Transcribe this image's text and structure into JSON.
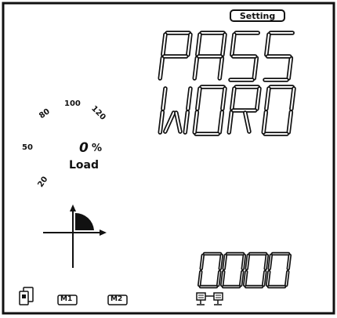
{
  "header": {
    "setting_label": "Setting"
  },
  "display": {
    "line1": "PASS",
    "line2": "WORD",
    "value": "0000"
  },
  "load_gauge": {
    "ticks": [
      "20",
      "50",
      "80",
      "100",
      "120"
    ],
    "percent_value": "0",
    "percent_symbol": "%",
    "label": "Load"
  },
  "footer": {
    "m1_label": "M1",
    "m2_label": "M2"
  },
  "icons": [
    "device-icon",
    "m1-icon",
    "m2-icon",
    "communication-icon",
    "quadrant-icon"
  ]
}
